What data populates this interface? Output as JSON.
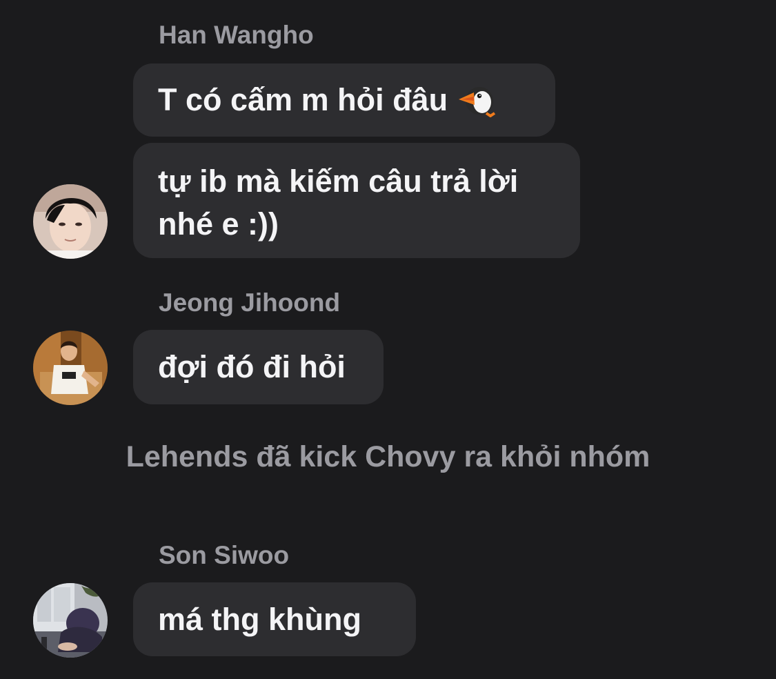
{
  "messages": [
    {
      "sender": "Han Wangho",
      "avatar_icon": "avatar-han-wangho",
      "bubbles": [
        {
          "text": "T có cấm m hỏi đâu",
          "emoji": "puffin-emoji"
        },
        {
          "lines": [
            "tự ib mà kiếm câu trả lời",
            "nhé e :))"
          ]
        }
      ]
    },
    {
      "sender": "Jeong Jihoond",
      "avatar_icon": "avatar-jeong-jihoond",
      "bubbles": [
        {
          "text": "đợi đó đi hỏi"
        }
      ]
    },
    {
      "sender": "Son Siwoo",
      "avatar_icon": "avatar-son-siwoo",
      "bubbles": [
        {
          "text": "má thg khùng"
        }
      ]
    }
  ],
  "system_notice": "Lehends đã kick Chovy ra khỏi nhóm",
  "colors": {
    "background": "#1b1b1d",
    "bubble": "#2d2d30",
    "sender_name": "#9b9ba1",
    "message_text": "#f4f4f6"
  }
}
